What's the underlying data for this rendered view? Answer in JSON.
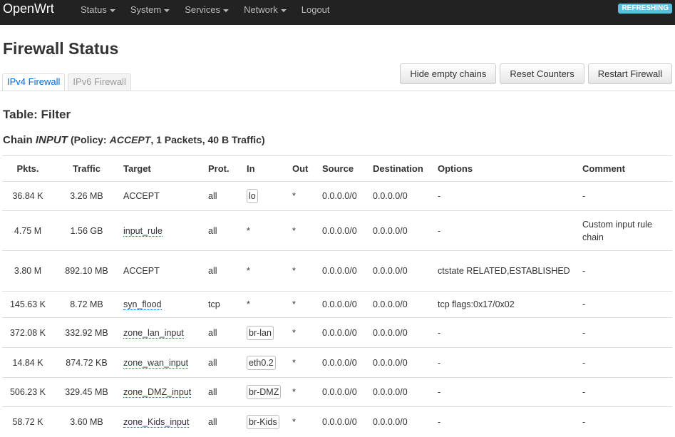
{
  "navbar": {
    "brand": "OpenWrt",
    "menu": [
      {
        "label": "Status",
        "dropdown": true
      },
      {
        "label": "System",
        "dropdown": true
      },
      {
        "label": "Services",
        "dropdown": true
      },
      {
        "label": "Network",
        "dropdown": true
      },
      {
        "label": "Logout",
        "dropdown": false
      }
    ],
    "badge": "REFRESHING"
  },
  "page": {
    "title": "Firewall Status",
    "tabs": [
      {
        "label": "IPv4 Firewall",
        "active": true
      },
      {
        "label": "IPv6 Firewall",
        "active": false
      }
    ],
    "buttons": {
      "hide_empty": "Hide empty chains",
      "reset": "Reset Counters",
      "restart": "Restart Firewall"
    },
    "table_title": "Table: Filter",
    "chain": {
      "prefix": "Chain",
      "name": "INPUT",
      "policy_open": "(Policy:",
      "policy": "ACCEPT",
      "stats": ", 1 Packets, 40 B Traffic)"
    }
  },
  "table": {
    "headers": [
      "Pkts.",
      "Traffic",
      "Target",
      "Prot.",
      "In",
      "Out",
      "Source",
      "Destination",
      "Options",
      "Comment"
    ],
    "rows": [
      {
        "pkts": "36.84 K",
        "traffic": "3.26 MB",
        "target": "ACCEPT",
        "target_link": false,
        "prot": "all",
        "in": "lo",
        "in_badge": true,
        "out": "*",
        "source": "0.0.0.0/0",
        "destination": "0.0.0.0/0",
        "options": "-",
        "comment": "-"
      },
      {
        "pkts": "4.75 M",
        "traffic": "1.56 GB",
        "target": "input_rule",
        "target_link": true,
        "prot": "all",
        "in": "*",
        "in_badge": false,
        "out": "*",
        "source": "0.0.0.0/0",
        "destination": "0.0.0.0/0",
        "options": "-",
        "comment": "Custom input rule chain"
      },
      {
        "pkts": "3.80 M",
        "traffic": "892.10 MB",
        "target": "ACCEPT",
        "target_link": false,
        "prot": "all",
        "in": "*",
        "in_badge": false,
        "out": "*",
        "source": "0.0.0.0/0",
        "destination": "0.0.0.0/0",
        "options": "ctstate RELATED,ESTABLISHED",
        "comment": "-"
      },
      {
        "pkts": "145.63 K",
        "traffic": "8.72 MB",
        "target": "syn_flood",
        "target_link": true,
        "prot": "tcp",
        "in": "*",
        "in_badge": false,
        "out": "*",
        "source": "0.0.0.0/0",
        "destination": "0.0.0.0/0",
        "options": "tcp flags:0x17/0x02",
        "comment": "-"
      },
      {
        "pkts": "372.08 K",
        "traffic": "332.92 MB",
        "target": "zone_lan_input",
        "target_link": true,
        "prot": "all",
        "in": "br-lan",
        "in_badge": true,
        "out": "*",
        "source": "0.0.0.0/0",
        "destination": "0.0.0.0/0",
        "options": "-",
        "comment": "-"
      },
      {
        "pkts": "14.84 K",
        "traffic": "874.72 KB",
        "target": "zone_wan_input",
        "target_link": true,
        "prot": "all",
        "in": "eth0.2",
        "in_badge": true,
        "out": "*",
        "source": "0.0.0.0/0",
        "destination": "0.0.0.0/0",
        "options": "-",
        "comment": "-"
      },
      {
        "pkts": "506.23 K",
        "traffic": "329.45 MB",
        "target": "zone_DMZ_input",
        "target_link": true,
        "prot": "all",
        "in": "br-DMZ",
        "in_badge": true,
        "out": "*",
        "source": "0.0.0.0/0",
        "destination": "0.0.0.0/0",
        "options": "-",
        "comment": "-"
      },
      {
        "pkts": "58.72 K",
        "traffic": "3.60 MB",
        "target": "zone_Kids_input",
        "target_link": true,
        "prot": "all",
        "in": "br-Kids",
        "in_badge": true,
        "out": "*",
        "source": "0.0.0.0/0",
        "destination": "0.0.0.0/0",
        "options": "-",
        "comment": "-"
      }
    ]
  }
}
